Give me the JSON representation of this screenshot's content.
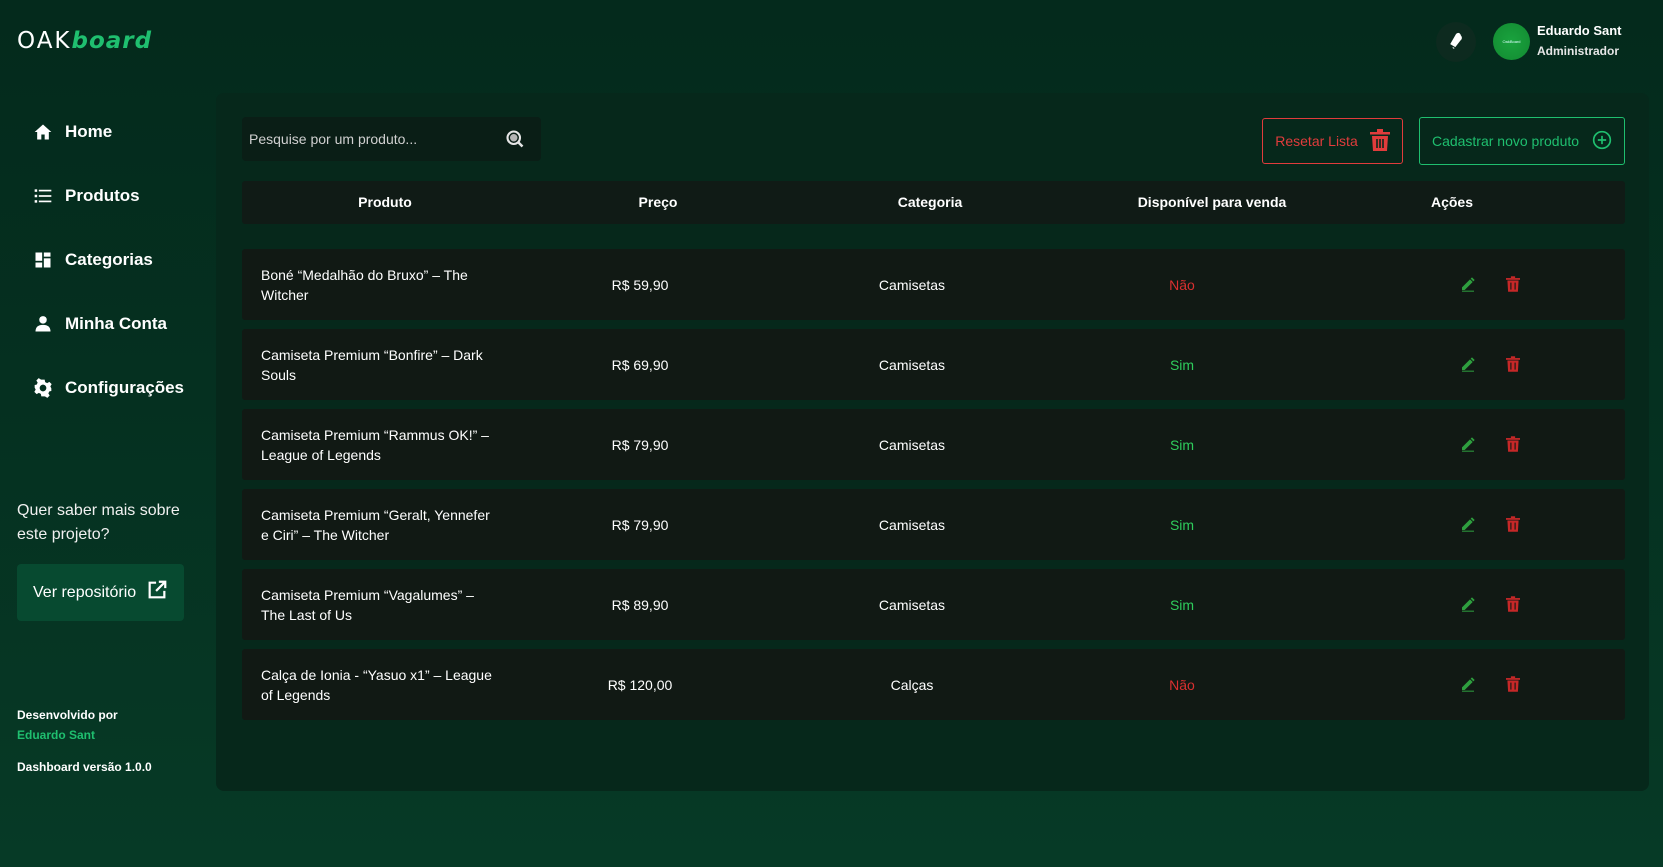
{
  "brand": {
    "part1": "OAK",
    "part2": "board"
  },
  "user": {
    "name": "Eduardo Sant",
    "role": "Administrador",
    "avatar_text": "OakBoard"
  },
  "nav": [
    {
      "label": "Home",
      "icon": "home-icon"
    },
    {
      "label": "Produtos",
      "icon": "list-icon"
    },
    {
      "label": "Categorias",
      "icon": "grid-icon"
    },
    {
      "label": "Minha Conta",
      "icon": "user-icon"
    },
    {
      "label": "Configurações",
      "icon": "gear-icon"
    }
  ],
  "promo": {
    "text": "Quer saber mais sobre este projeto?",
    "button": "Ver repositório"
  },
  "footer": {
    "dev_label": "Desenvolvido por",
    "dev_name": "Eduardo Sant",
    "version": "Dashboard versão 1.0.0"
  },
  "toolbar": {
    "search_placeholder": "Pesquise por um produto...",
    "reset_label": "Resetar Lista",
    "add_label": "Cadastrar novo produto"
  },
  "table": {
    "headers": [
      "Produto",
      "Preço",
      "Categoria",
      "Disponível para venda",
      "Ações"
    ],
    "rows": [
      {
        "name": "Boné “Medalhão do Bruxo” – The Witcher",
        "price": "R$ 59,90",
        "category": "Camisetas",
        "available": "Não"
      },
      {
        "name": "Camiseta Premium “Bonfire” – Dark Souls",
        "price": "R$ 69,90",
        "category": "Camisetas",
        "available": "Sim"
      },
      {
        "name": "Camiseta Premium “Rammus OK!” – League of Legends",
        "price": "R$ 79,90",
        "category": "Camisetas",
        "available": "Sim"
      },
      {
        "name": "Camiseta Premium “Geralt, Yennefer e Ciri” – The Witcher",
        "price": "R$ 79,90",
        "category": "Camisetas",
        "available": "Sim"
      },
      {
        "name": "Camiseta Premium “Vagalumes” – The Last of Us",
        "price": "R$ 89,90",
        "category": "Camisetas",
        "available": "Sim"
      },
      {
        "name": "Calça de Ionia - “Yasuo x1” – League of Legends",
        "price": "R$ 120,00",
        "category": "Calças",
        "available": "Não"
      }
    ]
  },
  "colors": {
    "accent": "#1fbf6f",
    "danger": "#e03c3c",
    "yes": "#2ecc5c",
    "no": "#d83030"
  }
}
